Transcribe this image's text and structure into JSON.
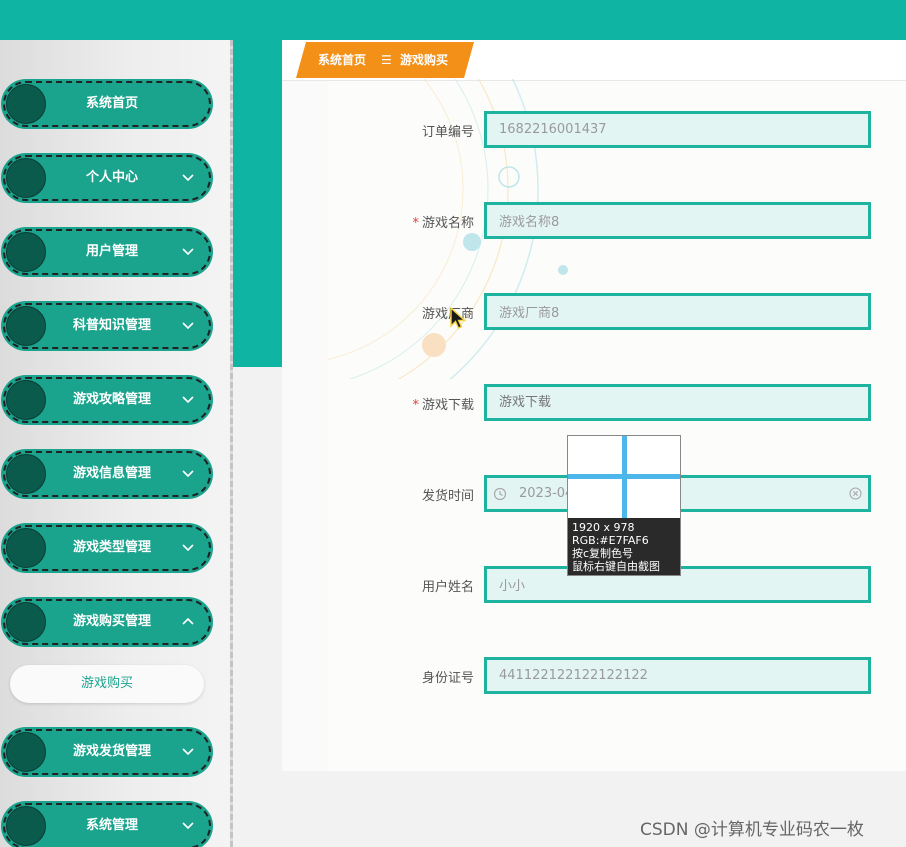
{
  "sidebar": {
    "items": [
      {
        "label": "系统首页",
        "chevron": "none"
      },
      {
        "label": "个人中心",
        "chevron": "down"
      },
      {
        "label": "用户管理",
        "chevron": "down"
      },
      {
        "label": "科普知识管理",
        "chevron": "down"
      },
      {
        "label": "游戏攻略管理",
        "chevron": "down"
      },
      {
        "label": "游戏信息管理",
        "chevron": "down"
      },
      {
        "label": "游戏类型管理",
        "chevron": "down"
      },
      {
        "label": "游戏购买管理",
        "chevron": "up"
      },
      {
        "label": "游戏发货管理",
        "chevron": "down"
      },
      {
        "label": "系统管理",
        "chevron": "down"
      }
    ],
    "sub_item": "游戏购买"
  },
  "breadcrumb": {
    "home": "系统首页",
    "separator": "☰",
    "current": "游戏购买"
  },
  "form": {
    "order_no": {
      "label": "订单编号",
      "value": "1682216001437"
    },
    "game_name": {
      "label": "游戏名称",
      "value": "游戏名称8",
      "required": "*"
    },
    "vendor": {
      "label": "游戏厂商",
      "value": "游戏厂商8"
    },
    "download": {
      "label": "游戏下载",
      "placeholder": "游戏下载",
      "required": "*"
    },
    "ship_time": {
      "label": "发货时间",
      "value": "2023-04"
    },
    "user_name": {
      "label": "用户姓名",
      "value": "小小"
    },
    "id_card": {
      "label": "身份证号",
      "value": "441122122122122122"
    }
  },
  "picker": {
    "size": "1920 x 978",
    "rgb": "RGB:#E7FAF6",
    "copy_hint": "按c复制色号",
    "capture_hint": "鼠标右键自由截图"
  },
  "watermark": "CSDN @计算机专业码农一枚",
  "colors": {
    "accent": "#0fb5a2",
    "menu": "#1aa38d",
    "breadcrumb": "#f39018"
  }
}
